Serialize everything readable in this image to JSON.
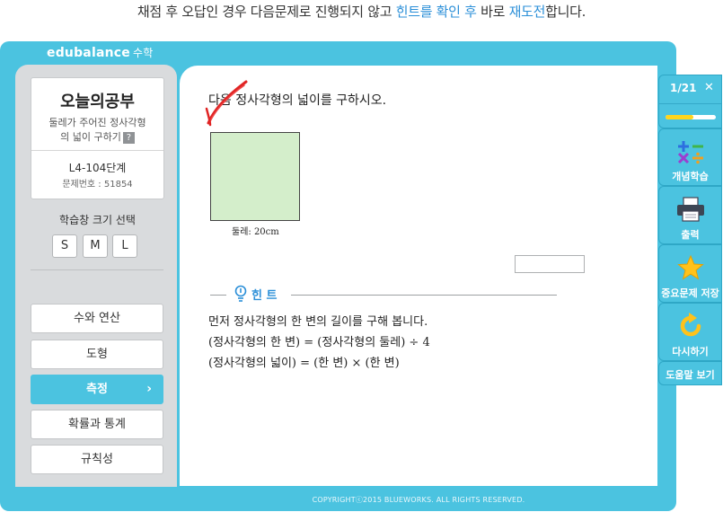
{
  "caption": {
    "part1": "채점 후 오답인 경우 다음문제로 진행되지 않고 ",
    "highlight1": "힌트를 확인 후",
    "part2": " 바로 ",
    "highlight2": "재도전",
    "part3": "합니다."
  },
  "brand": {
    "name": "edubalance",
    "subject": "수학"
  },
  "lesson": {
    "title": "오늘의공부",
    "desc_line1": "둘레가 주어진 정사각형",
    "desc_line2": "의 넓이 구하기",
    "help_icon": "?",
    "level": "L4-104단계",
    "problem_no": "문제번호 : 51854"
  },
  "size_selector": {
    "label": "학습창 크기 선택",
    "options": [
      "S",
      "M",
      "L"
    ]
  },
  "menu": {
    "items": [
      {
        "label": "수와 연산",
        "active": false
      },
      {
        "label": "도형",
        "active": false
      },
      {
        "label": "측정",
        "active": true
      },
      {
        "label": "확률과 통계",
        "active": false
      },
      {
        "label": "규칙성",
        "active": false
      }
    ],
    "active_chevron": "›"
  },
  "problem": {
    "question": "다음 정사각형의 넓이를 구하시오.",
    "figure_label": "둘레: 20cm",
    "answer_value": ""
  },
  "hint": {
    "title": "힌 트",
    "lines": [
      "먼저 정사각형의 한 변의 길이를 구해 봅니다.",
      "(정사각형의 한 변) = (정사각형의 둘레) ÷ 4",
      "(정사각형의 넓이) = (한 변) × (한 변)"
    ]
  },
  "right_panel": {
    "page": "1/21",
    "close_icon": "✕",
    "progress_fraction": 0.55,
    "buttons": [
      {
        "label": "개념학습",
        "icon": "math-operators-icon"
      },
      {
        "label": "출력",
        "icon": "printer-icon"
      },
      {
        "label": "중요문제 저장",
        "icon": "star-icon"
      },
      {
        "label": "다시하기",
        "icon": "retry-icon"
      },
      {
        "label": "도움말 보기",
        "icon": ""
      }
    ]
  },
  "footer": {
    "copyright": "COPYRIGHTⓒ2015 BLUEWORKS. ALL RIGHTS RESERVED."
  },
  "colors": {
    "frame": "#4bc3e0",
    "accent_text": "#2b8fd8",
    "square_fill": "#d4eecb",
    "progress": "#ffd51c",
    "check_mark": "#e02424"
  }
}
